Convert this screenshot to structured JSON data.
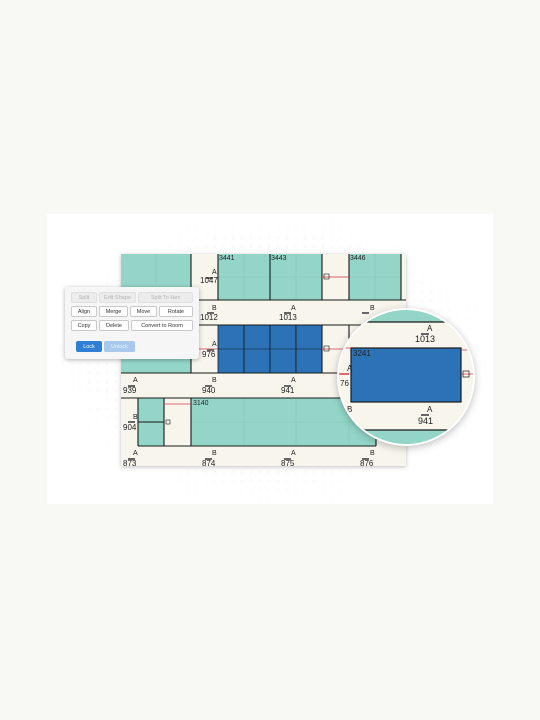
{
  "colors": {
    "room_teal": "#93d6c7",
    "room_selected": "#2b72b6",
    "wall": "#1a1a1a",
    "background_plan": "#f7f5ec",
    "boundary_red": "#d93a4a",
    "primary_button": "#2f7fd7"
  },
  "toolbar": {
    "split": "Split",
    "edit_shape": "Edit Shape",
    "split_to_hex": "Split To Hex",
    "align": "Align",
    "merge": "Merge",
    "move": "Move",
    "rotate": "Rotate",
    "copy": "Copy",
    "delete": "Delete",
    "convert_to_room": "Convert to Room",
    "lock": "Lock",
    "unlock": "Unlock"
  },
  "plan": {
    "rooms": {
      "r3441": "3441",
      "r3443": "3443",
      "r3446": "3446",
      "r3140": "3140"
    },
    "doors": {
      "d1047": "1047",
      "d1012": "1012",
      "d1013": "1013",
      "d976": "976",
      "d939": "939",
      "d940": "940",
      "d941": "941",
      "d904": "904",
      "d873": "873",
      "d874": "874",
      "d875": "875",
      "d876": "876"
    },
    "aisles": {
      "a": "A",
      "b": "B"
    }
  },
  "zoom": {
    "room": "3241",
    "door_top": "1013",
    "door_bottom": "941",
    "partial_left_top": "2",
    "partial_left_mid": "76",
    "aisle_a": "A",
    "aisle_b": "B"
  }
}
